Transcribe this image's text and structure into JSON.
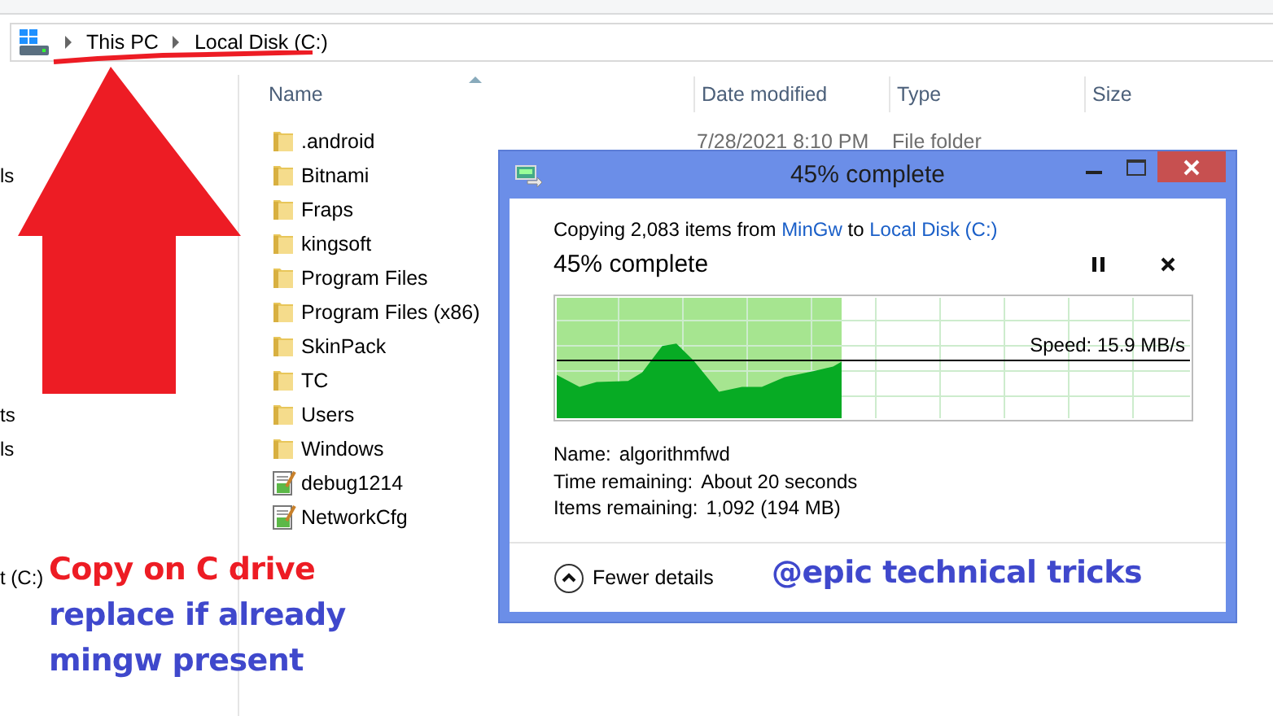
{
  "address_bar": {
    "crumbs": [
      "This PC",
      "Local Disk (C:)"
    ]
  },
  "nav_pane": {
    "items": [
      "ls",
      "ts",
      "ls",
      "t (C:)"
    ]
  },
  "columns": [
    {
      "label": "Name",
      "sorted": true
    },
    {
      "label": "Date modified",
      "sorted": false
    },
    {
      "label": "Type",
      "sorted": false
    },
    {
      "label": "Size",
      "sorted": false
    }
  ],
  "files": [
    {
      "name": ".android",
      "date": "7/28/2021 8:10 PM",
      "type": "File folder",
      "kind": "folder"
    },
    {
      "name": "Bitnami",
      "kind": "folder"
    },
    {
      "name": "Fraps",
      "kind": "folder"
    },
    {
      "name": "kingsoft",
      "kind": "folder"
    },
    {
      "name": "Program Files",
      "kind": "folder"
    },
    {
      "name": "Program Files (x86)",
      "kind": "folder"
    },
    {
      "name": "SkinPack",
      "kind": "folder"
    },
    {
      "name": "TC",
      "kind": "folder"
    },
    {
      "name": "Users",
      "kind": "folder"
    },
    {
      "name": "Windows",
      "kind": "folder"
    },
    {
      "name": "debug1214",
      "kind": "text"
    },
    {
      "name": "NetworkCfg",
      "kind": "text"
    }
  ],
  "copy_dialog": {
    "title": "45% complete",
    "summary": {
      "prefix": "Copying 2,083 items from",
      "source": "MinGw",
      "middle": "to",
      "destination": "Local Disk (C:)"
    },
    "heading": "45% complete",
    "level": 0.45,
    "speed": "Speed: 15.9 MB/s",
    "details": [
      {
        "label": "Name:",
        "value": "algorithmfwd"
      },
      {
        "label": "Time remaining:",
        "value": "About 20 seconds"
      },
      {
        "label": "Items remaining:",
        "value": "1,092 (194 MB)"
      }
    ],
    "toggle": "Fewer details"
  },
  "annotations": [
    {
      "text": "Copy on C drive",
      "color": "#ed1c24"
    },
    {
      "text": "replace if already",
      "color": "#3f48cc"
    },
    {
      "text": "mingw present",
      "color": "#3f48cc"
    },
    {
      "text": "@epic technical tricks",
      "color": "#3f48cc"
    }
  ]
}
